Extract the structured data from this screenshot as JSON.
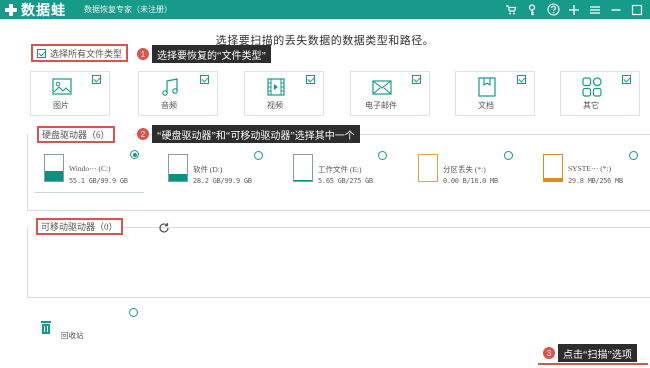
{
  "titlebar": {
    "logo_text": "数据蛙",
    "subtitle": "数据恢复专家（未注册）",
    "icons": [
      "cart-icon",
      "key-icon",
      "help-icon",
      "plus-icon",
      "menu-icon",
      "minimize-icon",
      "close-icon"
    ]
  },
  "headline": "选择要扫描的丢失数据的数据类型和路径。",
  "select_all": {
    "label": "选择所有文件类型",
    "checked": true
  },
  "callouts": [
    {
      "num": "1",
      "text": "选择要恢复的“文件类型”"
    },
    {
      "num": "2",
      "text": "“硬盘驱动器”和“可移动驱动器”选择其中一个"
    },
    {
      "num": "3",
      "text": "点击“扫描”选项"
    }
  ],
  "file_types": [
    {
      "label": "图片",
      "icon": "image-icon",
      "checked": true
    },
    {
      "label": "音频",
      "icon": "music-icon",
      "checked": true
    },
    {
      "label": "视频",
      "icon": "film-icon",
      "checked": true
    },
    {
      "label": "电子邮件",
      "icon": "mail-icon",
      "checked": true
    },
    {
      "label": "文档",
      "icon": "document-icon",
      "checked": true
    },
    {
      "label": "其它",
      "icon": "apps-icon",
      "checked": true
    }
  ],
  "hard_drives": {
    "title": "硬盘驱动器（6）",
    "drives": [
      {
        "name": "Windo··· (C:)",
        "size": "55.1 GB/99.9 GB",
        "used": 0.55,
        "selected": true,
        "color": "#0f8f80"
      },
      {
        "name": "软件 (D:)",
        "size": "28.2 GB/99.9 GB",
        "used": 0.28,
        "selected": false,
        "color": "#0f8f80"
      },
      {
        "name": "工作文件 (E:)",
        "size": "5.65 GB/275 GB",
        "used": 0.02,
        "selected": false,
        "color": "#0f8f80"
      },
      {
        "name": "分区丢失 (*:)",
        "size": "0.00  B/16.0 MB",
        "used": 0.0,
        "selected": false,
        "color": "#e8a33d"
      },
      {
        "name": "SYSTE··· (*:)",
        "size": "29.8 MB/256 MB",
        "used": 0.12,
        "selected": false,
        "color": "#e08a1e"
      }
    ]
  },
  "removable": {
    "title": "可移动驱动器（0）"
  },
  "recycle_bin": {
    "label": "回收站"
  },
  "colors": {
    "accent": "#179a8a",
    "highlight": "#d9534f"
  }
}
